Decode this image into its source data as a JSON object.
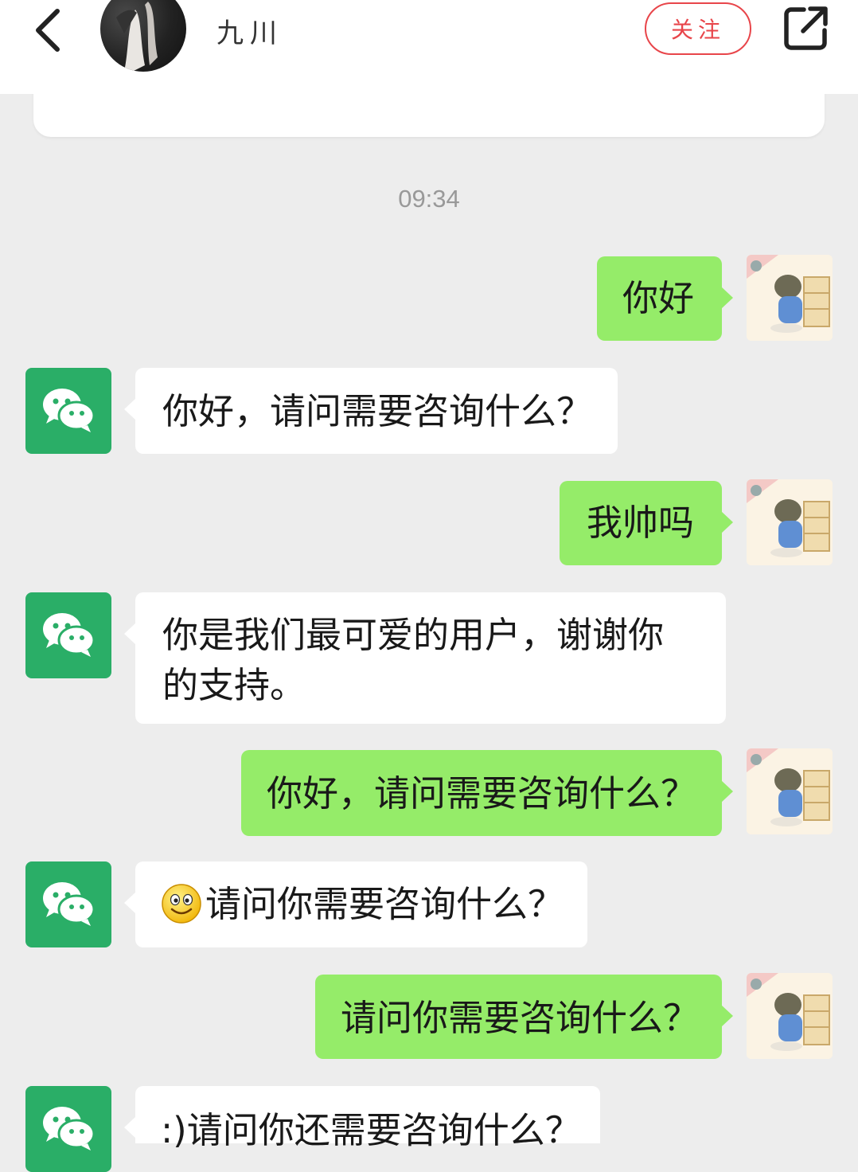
{
  "header": {
    "username": "九川",
    "follow_label": "关注"
  },
  "timestamp": "09:34",
  "messages": [
    {
      "side": "right",
      "text": "你好"
    },
    {
      "side": "left",
      "text": "你好，请问需要咨询什么？"
    },
    {
      "side": "right",
      "text": "我帅吗"
    },
    {
      "side": "left",
      "text": "你是我们最可爱的用户，谢谢你的支持。"
    },
    {
      "side": "right",
      "text": "你好，请问需要咨询什么？"
    },
    {
      "side": "left",
      "emoji": "smiley",
      "text": "请问你需要咨询什么？"
    },
    {
      "side": "right",
      "text": "请问你需要咨询什么？"
    },
    {
      "side": "left",
      "text": ":)请问你还需要咨询什么？"
    }
  ],
  "colors": {
    "sent_bubble": "#95ec69",
    "received_bubble": "#ffffff",
    "wechat_green": "#2aae67",
    "follow_red": "#e8454a",
    "background": "#ededed"
  },
  "icons": {
    "back": "back-chevron-icon",
    "share": "share-external-icon",
    "bot_avatar": "wechat-logo-icon"
  }
}
